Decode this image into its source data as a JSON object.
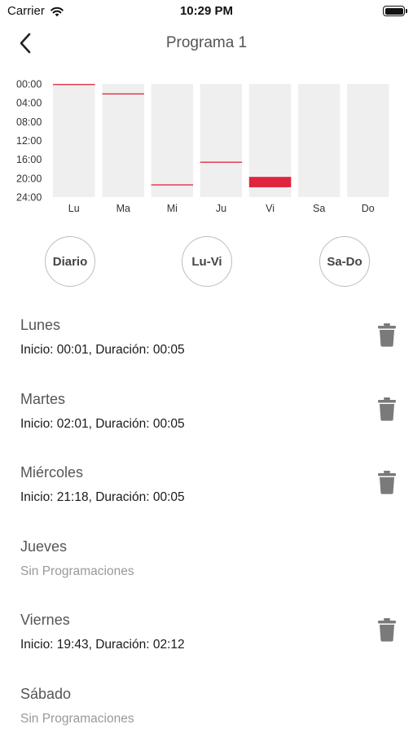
{
  "status_bar": {
    "carrier": "Carrier",
    "time": "10:29 PM"
  },
  "nav": {
    "title": "Programa 1",
    "back_icon": "chevron-left-icon"
  },
  "chart_data": {
    "type": "bar",
    "categories": [
      "Lu",
      "Ma",
      "Mi",
      "Ju",
      "Vi",
      "Sa",
      "Do"
    ],
    "y_ticks": [
      "00:00",
      "04:00",
      "08:00",
      "12:00",
      "16:00",
      "20:00",
      "24:00"
    ],
    "ylim": [
      0,
      24
    ],
    "series": [
      {
        "values": [
          {
            "day": "Lu",
            "start": "00:01",
            "duration": "00:05"
          },
          {
            "day": "Ma",
            "start": "02:01",
            "duration": "00:05"
          },
          {
            "day": "Mi",
            "start": "21:18",
            "duration": "00:05"
          },
          {
            "day": "Ju",
            "start": "16:30",
            "duration": "00:05"
          },
          {
            "day": "Vi",
            "start": "19:43",
            "duration": "02:12"
          },
          {
            "day": "Sa",
            "start": null,
            "duration": null
          },
          {
            "day": "Do",
            "start": null,
            "duration": null
          }
        ]
      }
    ],
    "colors": {
      "background": "#efefef",
      "mark": "#e0243e"
    }
  },
  "quick_buttons": [
    "Diario",
    "Lu-Vi",
    "Sa-Do"
  ],
  "days": [
    {
      "name": "Lunes",
      "info": "Inicio: 00:01, Duración: 00:05",
      "has_delete": true
    },
    {
      "name": "Martes",
      "info": "Inicio: 02:01, Duración: 00:05",
      "has_delete": true
    },
    {
      "name": "Miércoles",
      "info": "Inicio: 21:18, Duración: 00:05",
      "has_delete": true
    },
    {
      "name": "Jueves",
      "info": "Sin Programaciones",
      "has_delete": false
    },
    {
      "name": "Viernes",
      "info": "Inicio: 19:43, Duración: 02:12",
      "has_delete": true
    },
    {
      "name": "Sábado",
      "info": "Sin Programaciones",
      "has_delete": false
    }
  ],
  "icons": {
    "delete": "trash-icon",
    "wifi": "wifi-icon",
    "battery": "battery-icon"
  }
}
